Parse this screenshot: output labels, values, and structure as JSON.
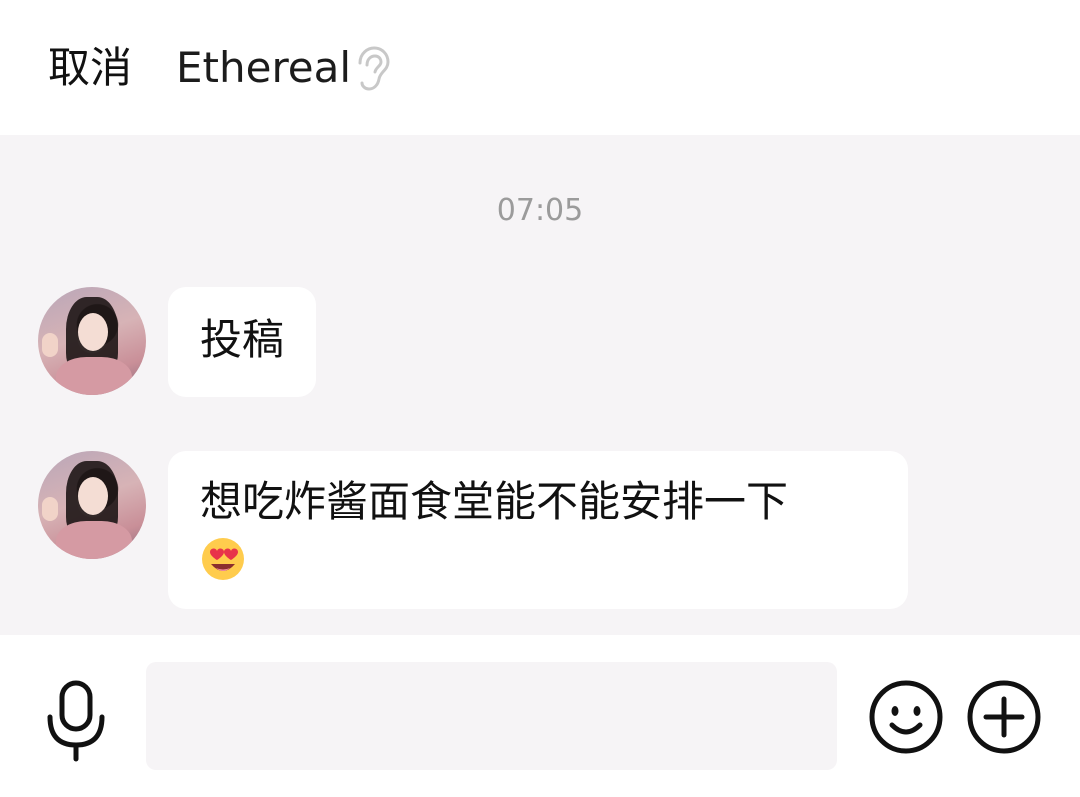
{
  "header": {
    "cancel_label": "取消",
    "title": "Ethereal",
    "mode_icon": "ear-icon"
  },
  "chat": {
    "timestamp": "07:05",
    "messages": [
      {
        "sender": "Ethereal",
        "text": "投稿"
      },
      {
        "sender": "Ethereal",
        "text": "想吃炸酱面食堂能不能安排一下",
        "emoji": "heart-eyes-emoji"
      }
    ]
  },
  "footer": {
    "input_value": "",
    "input_placeholder": "",
    "icons": [
      "microphone-icon",
      "smiley-icon",
      "plus-icon"
    ]
  },
  "colors": {
    "background": "#f6f4f6",
    "bubble": "#ffffff",
    "timestamp": "#9b9b9b",
    "text": "#111111"
  }
}
